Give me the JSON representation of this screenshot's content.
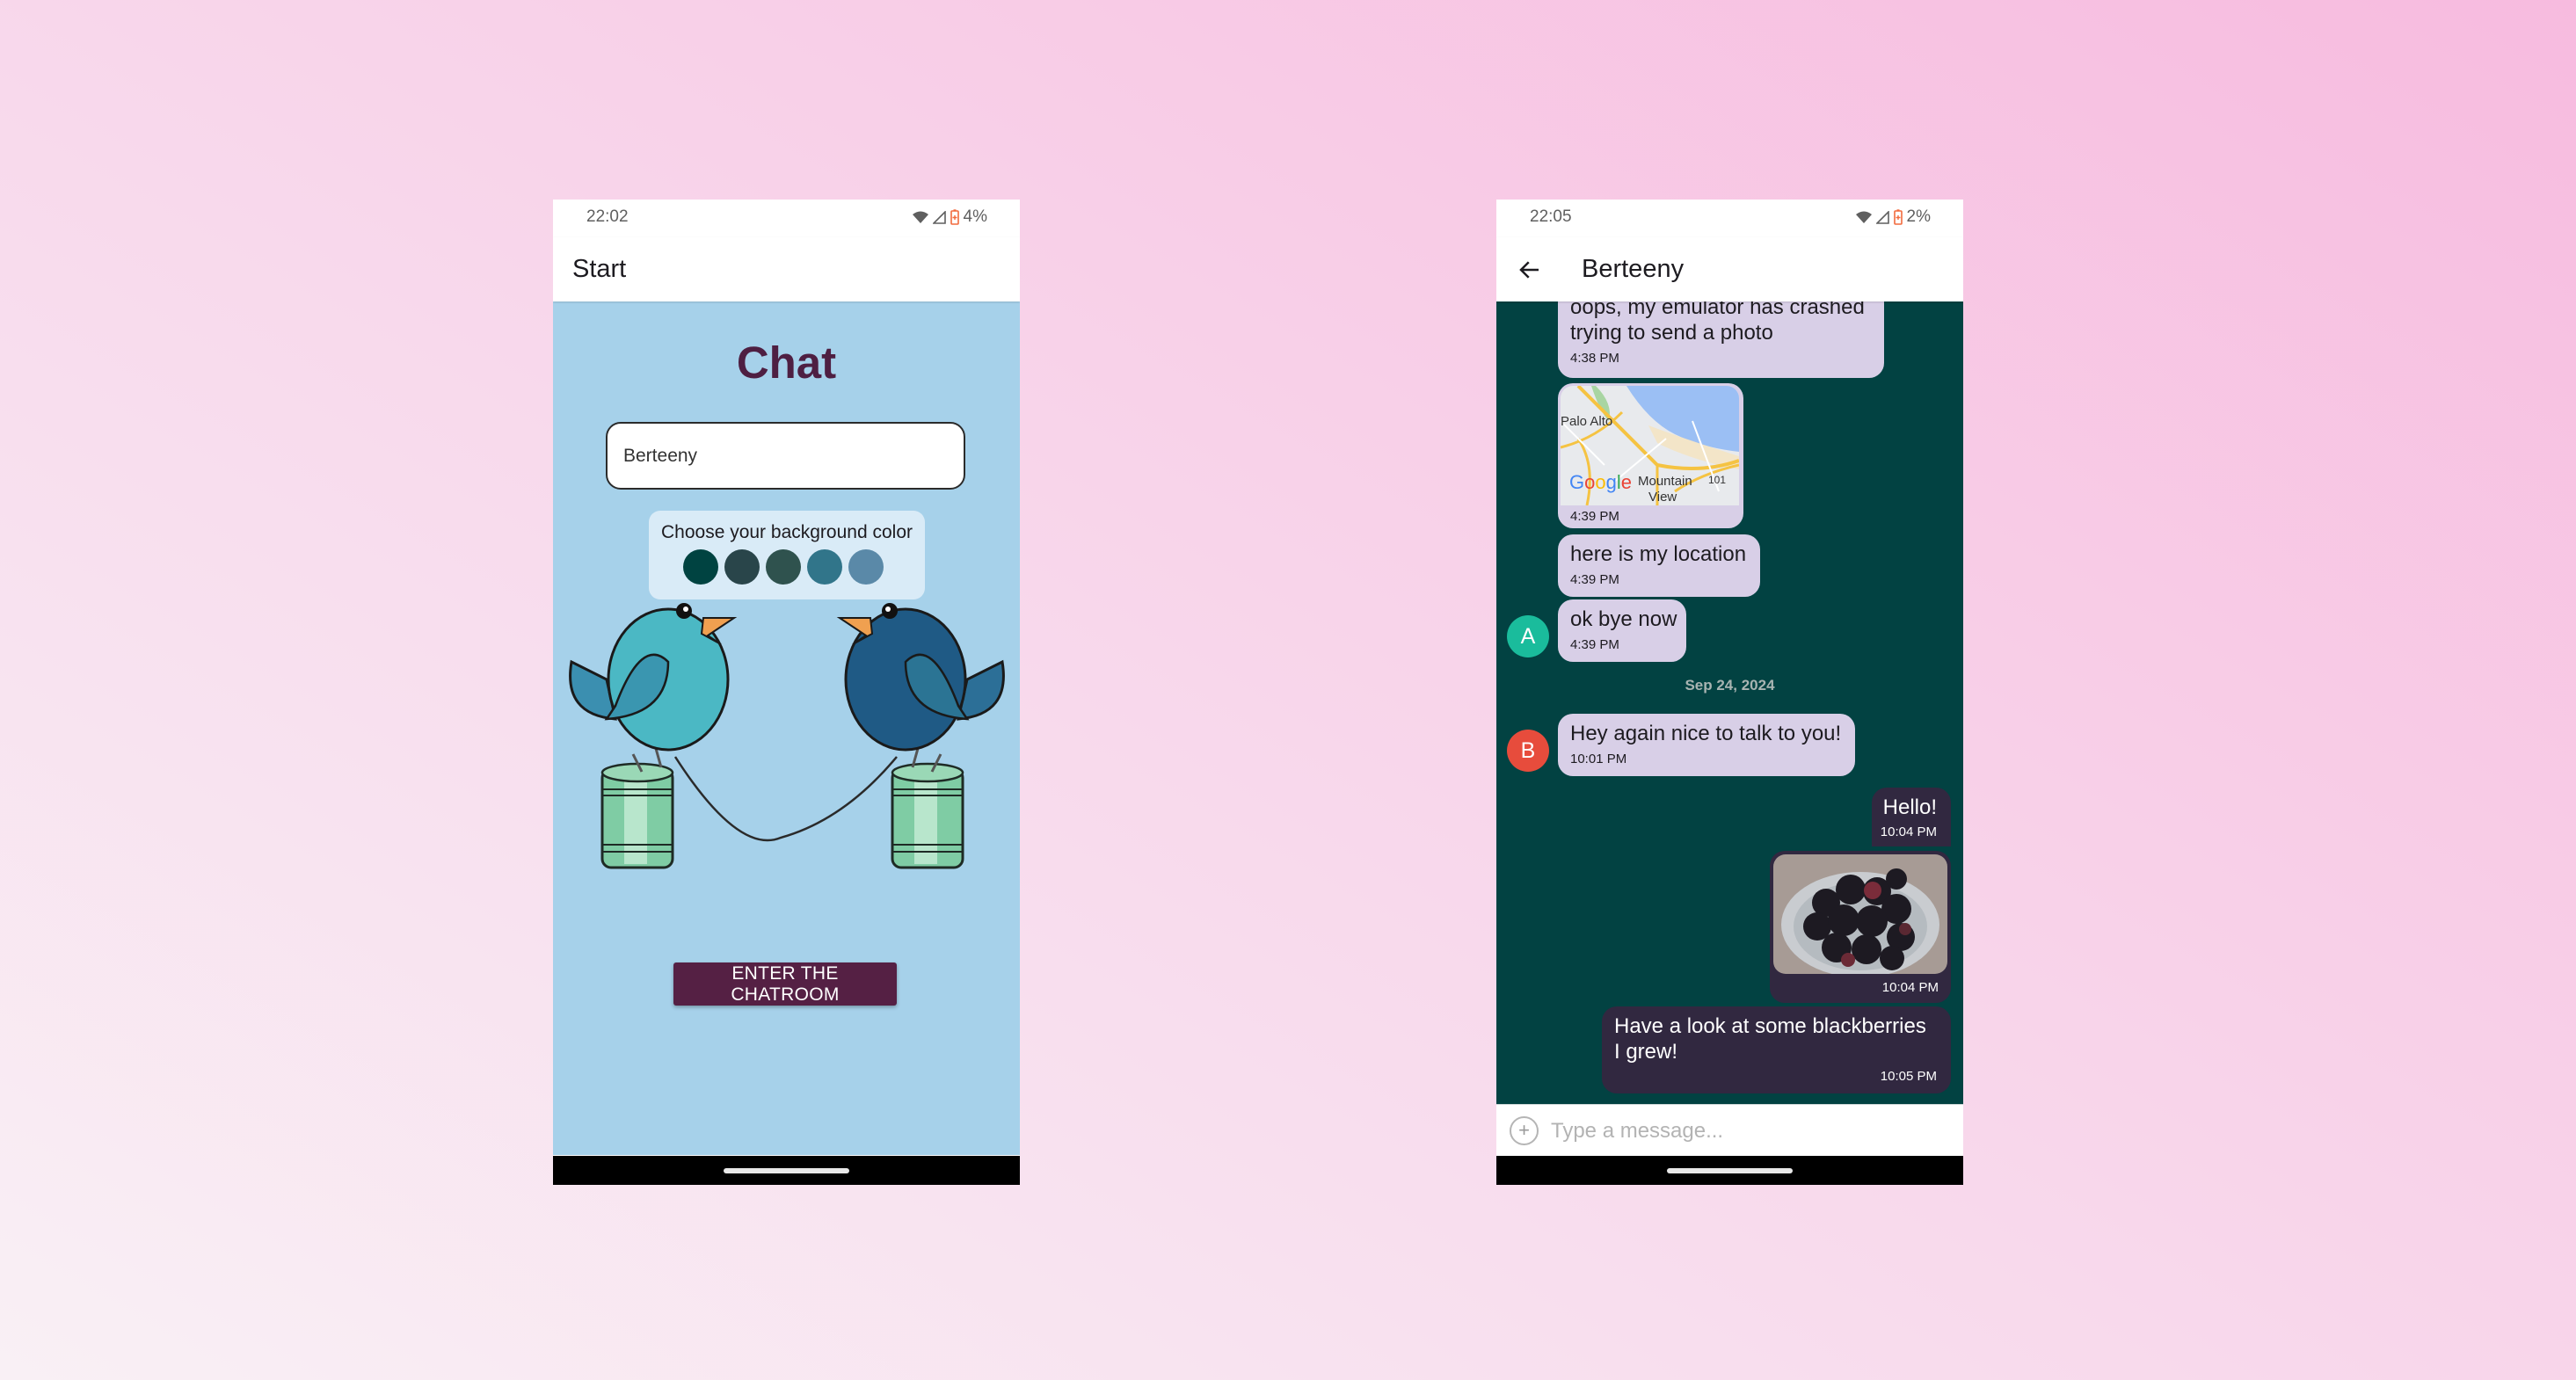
{
  "start_screen": {
    "status_bar": {
      "time": "22:02",
      "battery": "4%"
    },
    "app_bar_title": "Start",
    "title": "Chat",
    "name_input": {
      "value": "Berteeny",
      "placeholder": ""
    },
    "color_picker": {
      "label": "Choose your background color",
      "colors": [
        "#004341",
        "#29454a",
        "#2f524e",
        "#31758a",
        "#5a89a8"
      ]
    },
    "enter_button": "ENTER THE CHATROOM",
    "colors": {
      "background": "#a6d1ea",
      "title": "#4e1f42",
      "button": "#552044"
    }
  },
  "chat_screen": {
    "status_bar": {
      "time": "22:05",
      "battery": "2%"
    },
    "app_bar_title": "Berteeny",
    "colors": {
      "background": "#024242",
      "received_bubble": "#d8cfe7",
      "sent_bubble": "#312840"
    },
    "messages": [
      {
        "from": "other",
        "type": "text",
        "text": "oops, my emulator has crashed trying to send a photo",
        "time": "4:38 PM"
      },
      {
        "from": "other",
        "type": "map",
        "map_labels": [
          "Palo Alto",
          "Mountain View",
          "101",
          "Google"
        ],
        "time": "4:39 PM"
      },
      {
        "from": "other",
        "type": "text",
        "text": "here is my location",
        "time": "4:39 PM"
      },
      {
        "from": "other",
        "type": "text",
        "text": "ok bye now",
        "time": "4:39 PM",
        "avatar": "A",
        "avatar_color": "#1abc9c"
      },
      {
        "type": "date",
        "text": "Sep 24, 2024"
      },
      {
        "from": "other",
        "type": "text",
        "text": "Hey again nice to talk to you!",
        "time": "10:01 PM",
        "avatar": "B",
        "avatar_color": "#e74c3c"
      },
      {
        "from": "me",
        "type": "text",
        "text": "Hello!",
        "time": "10:04 PM"
      },
      {
        "from": "me",
        "type": "image",
        "image_desc": "bowl of blackberries",
        "time": "10:04 PM"
      },
      {
        "from": "me",
        "type": "text",
        "text": "Have a look at some blackberries I grew!",
        "time": "10:05 PM"
      }
    ],
    "composer": {
      "placeholder": "Type a message...",
      "value": ""
    }
  }
}
